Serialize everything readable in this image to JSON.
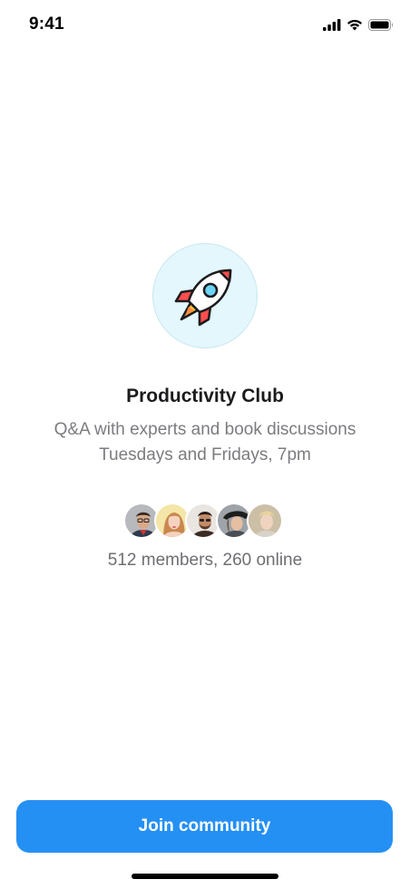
{
  "status_bar": {
    "time": "9:41",
    "icons": [
      "signal-icon",
      "wifi-icon",
      "battery-icon"
    ]
  },
  "community": {
    "logo_icon": "rocket-icon",
    "title": "Productivity Club",
    "description_line1": "Q&A with experts and book discussions",
    "description_line2": "Tuesdays and Fridays, 7pm",
    "members_text": "512 members, 260 online",
    "avatars": [
      "avatar-1",
      "avatar-2",
      "avatar-3",
      "avatar-4",
      "avatar-5"
    ]
  },
  "actions": {
    "join_label": "Join community"
  },
  "colors": {
    "accent": "#2590f4",
    "logo_bg": "#e3f7fd",
    "secondary_text": "#7c7c80"
  }
}
